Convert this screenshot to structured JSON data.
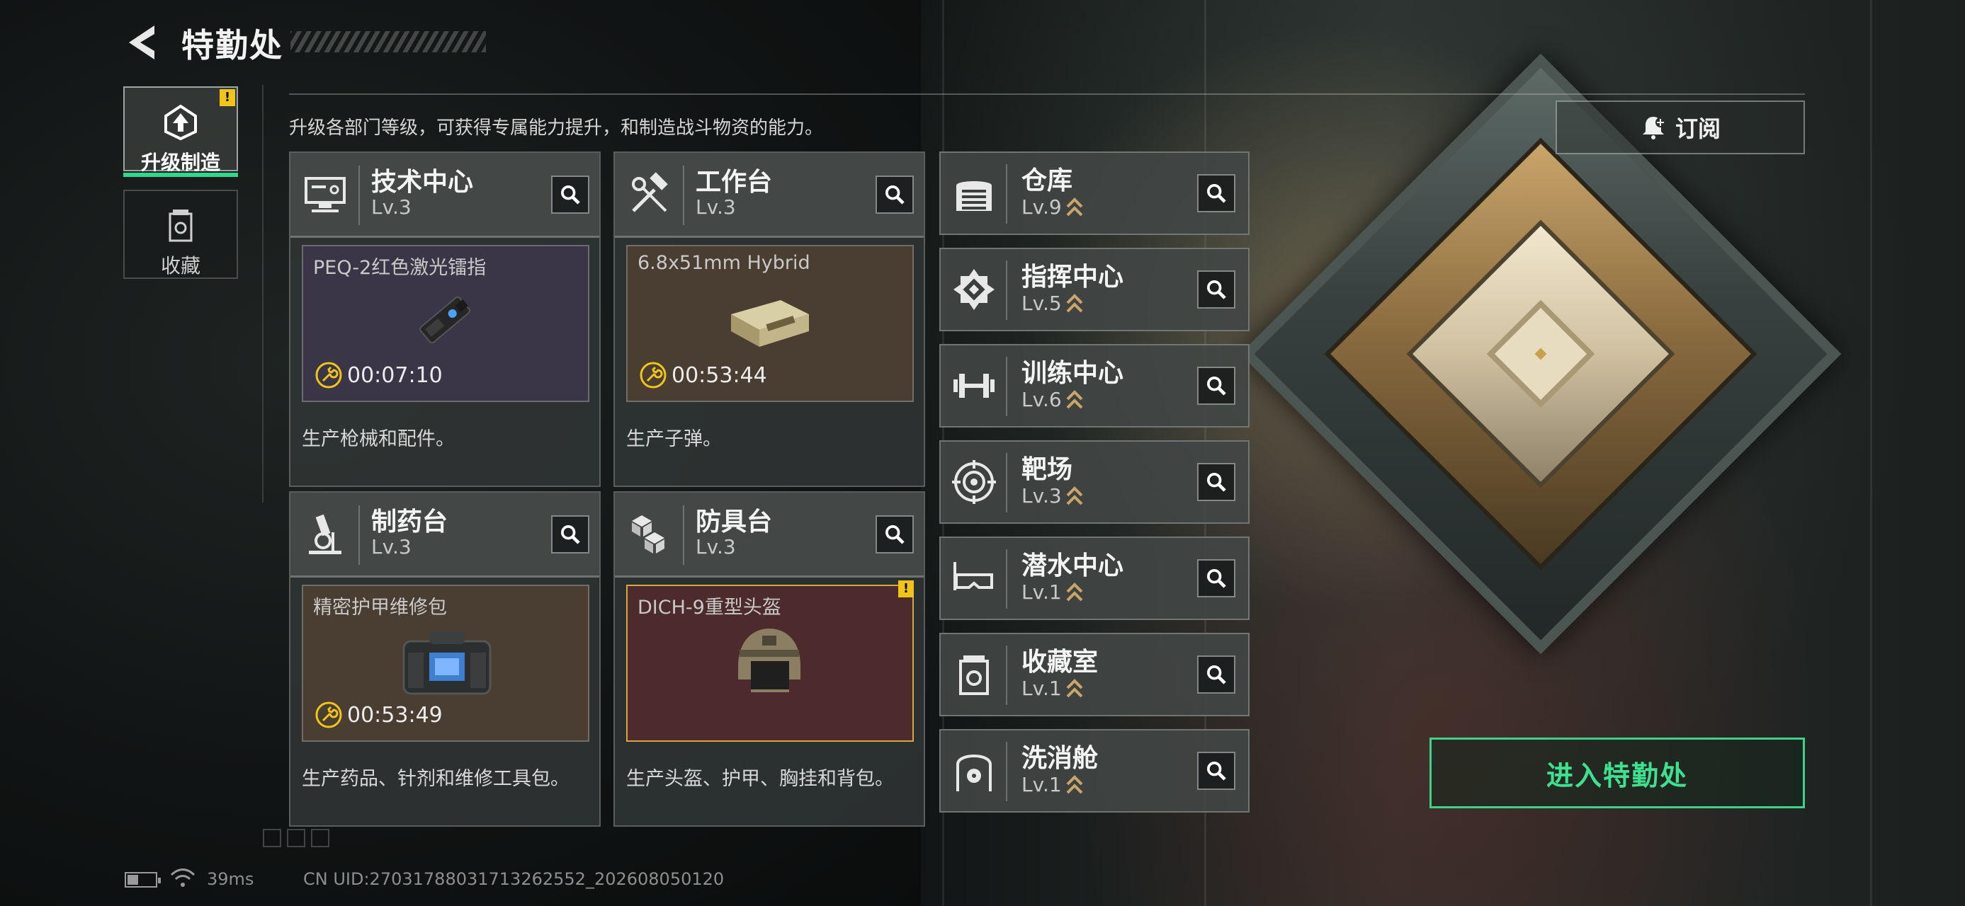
{
  "header": {
    "title": "特勤处",
    "back_icon": "back-arrow-icon"
  },
  "side_tabs": [
    {
      "label": "升级制造",
      "icon": "upgrade-icon",
      "active": true,
      "alert": "!"
    },
    {
      "label": "收藏",
      "icon": "collection-icon",
      "active": false
    }
  ],
  "intro": "升级各部门等级，可获得专属能力提升，和制造战斗物资的能力。",
  "subscribe": {
    "label": "订阅",
    "icon": "bell-plus-icon"
  },
  "workbenches": [
    {
      "name": "技术中心",
      "level": "Lv.3",
      "icon": "monitor-icon",
      "product": "PEQ-2红色激光镭指",
      "timer": "00:07:10",
      "desc": "生产枪械和配件。",
      "box_color": "#3a3648"
    },
    {
      "name": "工作台",
      "level": "Lv.3",
      "icon": "tools-icon",
      "product": "6.8x51mm Hybrid",
      "timer": "00:53:44",
      "desc": "生产子弹。",
      "box_color": "#4a3d31"
    },
    {
      "name": "制药台",
      "level": "Lv.3",
      "icon": "microscope-icon",
      "product": "精密护甲维修包",
      "timer": "00:53:49",
      "desc": "生产药品、针剂和维修工具包。",
      "box_color": "#4a3d31"
    },
    {
      "name": "防具台",
      "level": "Lv.3",
      "icon": "cubes-icon",
      "product": "DICH-9重型头盔",
      "timer": "",
      "desc": "生产头盔、护甲、胸挂和背包。",
      "box_color": "#4d2b2c",
      "alert": "!"
    }
  ],
  "facilities": [
    {
      "name": "仓库",
      "level": "Lv.9",
      "icon": "warehouse-icon"
    },
    {
      "name": "指挥中心",
      "level": "Lv.5",
      "icon": "command-icon"
    },
    {
      "name": "训练中心",
      "level": "Lv.6",
      "icon": "dumbbell-icon"
    },
    {
      "name": "靶场",
      "level": "Lv.3",
      "icon": "target-icon"
    },
    {
      "name": "潜水中心",
      "level": "Lv.1",
      "icon": "dive-mask-icon"
    },
    {
      "name": "收藏室",
      "level": "Lv.1",
      "icon": "collection-room-icon"
    },
    {
      "name": "洗消舱",
      "level": "Lv.1",
      "icon": "decon-icon"
    }
  ],
  "enter_button": "进入特勤处",
  "footer": {
    "ping": "39ms",
    "uid": "CN UID:27031788031713262552_202608050120",
    "battery": 0.4
  },
  "colors": {
    "accent_green": "#3fe08f",
    "alert_yellow": "#f0c419",
    "upgrade_gold": "#c9a56a"
  }
}
